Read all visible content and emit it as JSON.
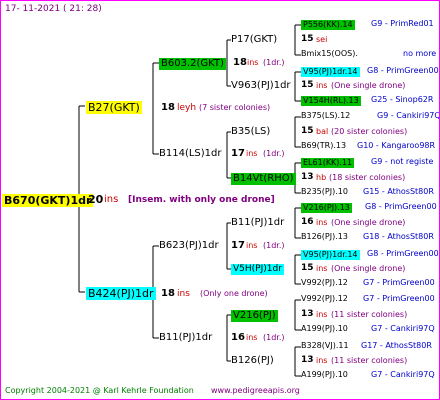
{
  "header": {
    "date": "17- 11-2021 ( 21: 28)"
  },
  "footer": {
    "copyright": "Copyright 2004-2021 @ Karl Kehrle Foundation",
    "site": "www.pedigreeapis.org"
  },
  "root": {
    "name": "B670(GKT)1dr",
    "ins_num": "20",
    "ins": "ins",
    "note": "[Insem. with only one drone]"
  },
  "gen1": [
    {
      "name": "B27(GKT)",
      "ins_num": "18",
      "ins": "leyh",
      "note": "(7 sister colonies)"
    },
    {
      "name": "B424(PJ)1dr",
      "ins_num": "18",
      "ins": "ins",
      "note": "(Only one drone)"
    }
  ],
  "gen2": [
    {
      "name": "B603.2(GKT)",
      "ins_num": "18",
      "ins": "ins",
      "note": "(1dr.)"
    },
    {
      "name": "B114(LS)1dr",
      "ins_num": "17",
      "ins": "ins",
      "note": "(1dr.)"
    },
    {
      "name": "B623(PJ)1dr",
      "ins_num": "17",
      "ins": "ins",
      "note": "(1dr.)"
    },
    {
      "name": "B11(PJ)1dr",
      "ins_num": "16",
      "ins": "ins",
      "note": "(1dr.)"
    }
  ],
  "gen3": [
    {
      "name": "P17(GKT)"
    },
    {
      "name": "V963(PJ)1dr"
    },
    {
      "name": "B35(LS)"
    },
    {
      "name": "B14Vt(RHO)"
    },
    {
      "name": "B11(PJ)1dr"
    },
    {
      "name": "V5H(PJ)1dr"
    },
    {
      "name": "V216(PJ)"
    },
    {
      "name": "B126(PJ)"
    }
  ],
  "gen4": [
    {
      "top": "P556(KK).14",
      "top_info": "G9 - PrimRed01",
      "num": "15",
      "ins": "sei",
      "note": "",
      "bottom": "Bmix15(OOS).",
      "bottom_info": "no more"
    },
    {
      "top": "V95(PJ)1dr.14",
      "top_info": "G8 - PrimGreen00",
      "num": "15",
      "ins": "ins",
      "note": "(One single drone)",
      "bottom": "V154H(RL).13",
      "bottom_info": "G25 - Sinop62R"
    },
    {
      "top": "B375(LS).12",
      "top_info": "G9 - Cankiri97Q",
      "num": "15",
      "ins": "bal",
      "note": "(20 sister colonies)",
      "bottom": "B69(TR).13",
      "bottom_info": "G10 - Kangaroo98R"
    },
    {
      "top": "EL61(KK).11",
      "top_info": "G9 - not registe",
      "num": "13",
      "ins": "hb",
      "note": "(18 sister colonies)",
      "bottom": "B235(PJ).10",
      "bottom_info": "G15 - AthosSt80R"
    },
    {
      "top": "V216(PJ).13",
      "top_info": "G8 - PrimGreen00",
      "num": "16",
      "ins": "ins",
      "note": "(One single drone)",
      "bottom": "B126(PJ).13",
      "bottom_info": "G18 - AthosSt80R"
    },
    {
      "top": "V95(PJ)1dr.14",
      "top_info": "G8 - PrimGreen00",
      "num": "15",
      "ins": "ins",
      "note": "(One single drone)",
      "bottom": "V992(PJ).12",
      "bottom_info": "G7 - PrimGreen00"
    },
    {
      "top": "V992(PJ).12",
      "top_info": "G7 - PrimGreen00",
      "num": "13",
      "ins": "ins",
      "note": "(11 sister colonies)",
      "bottom": "A199(PJ).10",
      "bottom_info": "G7 - Cankiri97Q"
    },
    {
      "top": "B328(VJ).11",
      "top_info": "G17 - AthosSt80R",
      "num": "13",
      "ins": "ins",
      "note": "(11 sister colonies)",
      "bottom": "A199(PJ).10",
      "bottom_info": "G7 - Cankiri97Q"
    }
  ]
}
